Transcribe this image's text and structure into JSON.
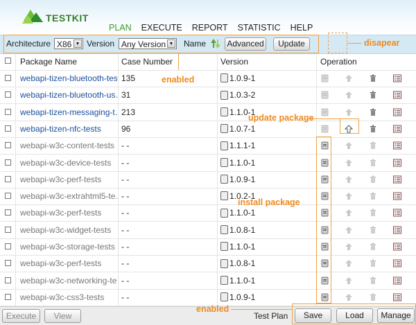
{
  "app": {
    "logo_text": "TESTKIT"
  },
  "nav": [
    "PLAN",
    "EXECUTE",
    "REPORT",
    "STATISTIC",
    "HELP"
  ],
  "toolbar": {
    "architecture_label": "Architecture",
    "architecture_value": "X86",
    "version_label": "Version",
    "version_value": "Any Version",
    "name_label": "Name",
    "advanced_label": "Advanced",
    "update_label": "Update"
  },
  "annotations": {
    "disappear": "disapear",
    "enabled_top": "enabled",
    "update_package": "update package",
    "install_package": "install package",
    "enabled_bottom": "enabled"
  },
  "table": {
    "headers": [
      "Package Name",
      "Case Number",
      "Version",
      "Operation"
    ],
    "rows": [
      {
        "name": "webapi-tizen-bluetooth-tests",
        "cases": "135",
        "version": "1.0.9-1",
        "installed": true
      },
      {
        "name": "webapi-tizen-bluetooth-us…",
        "cases": "31",
        "version": "1.0.3-2",
        "installed": true
      },
      {
        "name": "webapi-tizen-messaging-t…",
        "cases": "213",
        "version": "1.1.0-1",
        "installed": true
      },
      {
        "name": "webapi-tizen-nfc-tests",
        "cases": "96",
        "version": "1.0.7-1",
        "installed": true
      },
      {
        "name": "webapi-w3c-content-tests",
        "cases": "- -",
        "version": "1.1.1-1",
        "installed": false
      },
      {
        "name": "webapi-w3c-device-tests",
        "cases": "- -",
        "version": "1.1.0-1",
        "installed": false
      },
      {
        "name": "webapi-w3c-perf-tests",
        "cases": "- -",
        "version": "1.0.9-1",
        "installed": false
      },
      {
        "name": "webapi-w3c-extrahtml5-te…",
        "cases": "- -",
        "version": "1.0.2-1",
        "installed": false
      },
      {
        "name": "webapi-w3c-perf-tests",
        "cases": "- -",
        "version": "1.1.0-1",
        "installed": false
      },
      {
        "name": "webapi-w3c-widget-tests",
        "cases": "- -",
        "version": "1.0.8-1",
        "installed": false
      },
      {
        "name": "webapi-w3c-storage-tests",
        "cases": "- -",
        "version": "1.1.0-1",
        "installed": false
      },
      {
        "name": "webapi-w3c-perf-tests",
        "cases": "- -",
        "version": "1.0.8-1",
        "installed": false
      },
      {
        "name": "webapi-w3c-networking-te…",
        "cases": "- -",
        "version": "1.1.0-1",
        "installed": false
      },
      {
        "name": "webapi-w3c-css3-tests",
        "cases": "- -",
        "version": "1.0.9-1",
        "installed": false
      }
    ]
  },
  "bottom": {
    "execute_label": "Execute",
    "view_label": "View",
    "test_plan_label": "Test Plan",
    "save_label": "Save",
    "load_label": "Load",
    "manage_label": "Manage"
  },
  "colors": {
    "accent_green": "#3e9a2b",
    "annotation_orange": "#f08a1c",
    "link_blue": "#1b4f9a",
    "toolbar_bg": "#d4e9f4"
  }
}
